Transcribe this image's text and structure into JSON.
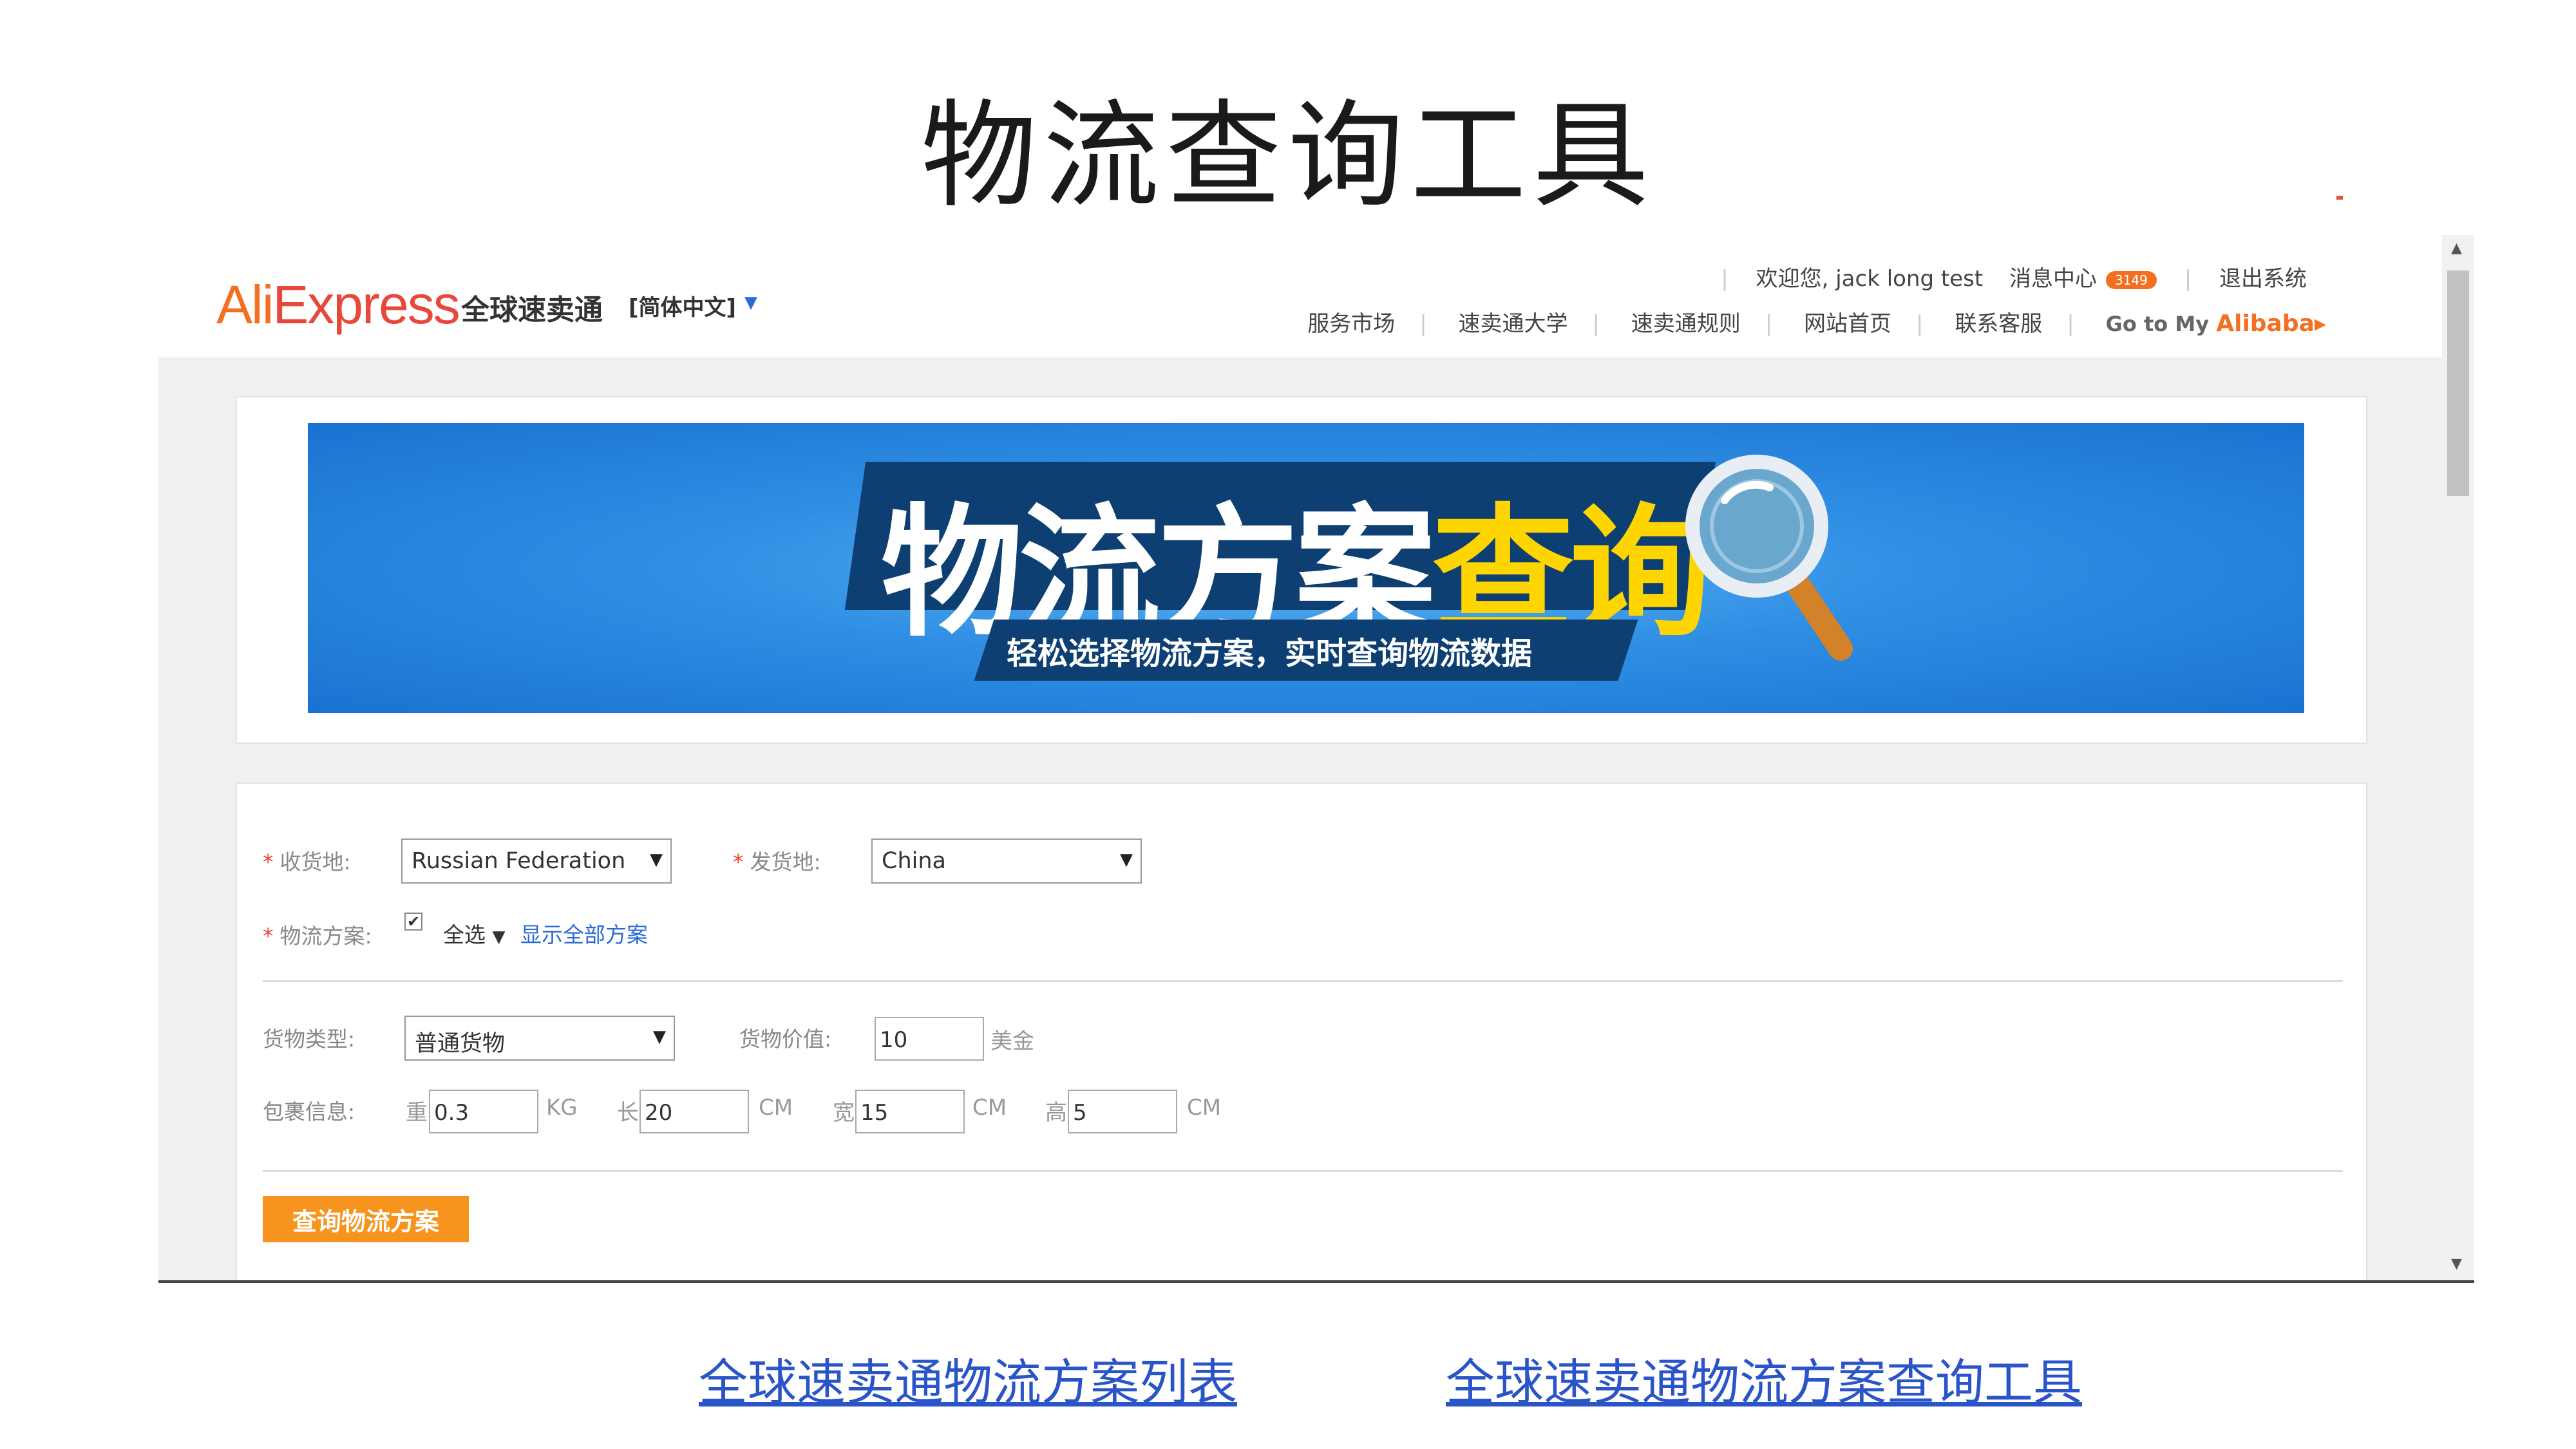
{
  "slide": {
    "title": "物流查询工具"
  },
  "header": {
    "logo_en_a": "Ali",
    "logo_en_b": "Express",
    "logo_cn": "全球速卖通",
    "language": "[简体中文]",
    "welcome": "欢迎您, jack long test",
    "message_center": "消息中心",
    "message_count": "3149",
    "logout": "退出系统",
    "nav": [
      "服务市场",
      "速卖通大学",
      "速卖通规则",
      "网站首页",
      "联系客服"
    ],
    "goto_prefix": "Go to My",
    "goto_brand": "Alibaba",
    "goto_arrow": "▸"
  },
  "banner": {
    "title_white": "物流方案",
    "title_yellow": "查询",
    "subtitle": "轻松选择物流方案，实时查询物流数据"
  },
  "form": {
    "destination_label": "收货地:",
    "destination_value": "Russian Federation",
    "origin_label": "发货地:",
    "origin_value": "China",
    "plan_label": "物流方案:",
    "select_all": "全选",
    "show_all": "显示全部方案",
    "cargo_type_label": "货物类型:",
    "cargo_type_value": "普通货物",
    "cargo_value_label": "货物价值:",
    "cargo_value": "10",
    "currency": "美金",
    "package_label": "包裹信息:",
    "weight_label": "重",
    "weight": "0.3",
    "weight_unit": "KG",
    "length_label": "长",
    "length": "20",
    "width_label": "宽",
    "width": "15",
    "height_label": "高",
    "height": "5",
    "dim_unit": "CM",
    "query_button": "查询物流方案"
  },
  "links": {
    "plan_list": "全球速卖通物流方案列表",
    "query_tool": "全球速卖通物流方案查询工具"
  },
  "colors": {
    "brand_orange": "#f36f21",
    "brand_red": "#e8483b",
    "button_orange": "#f7941d",
    "banner_blue": "#2f8ee4",
    "banner_yellow": "#ffd500",
    "link_blue": "#2a55c8"
  }
}
